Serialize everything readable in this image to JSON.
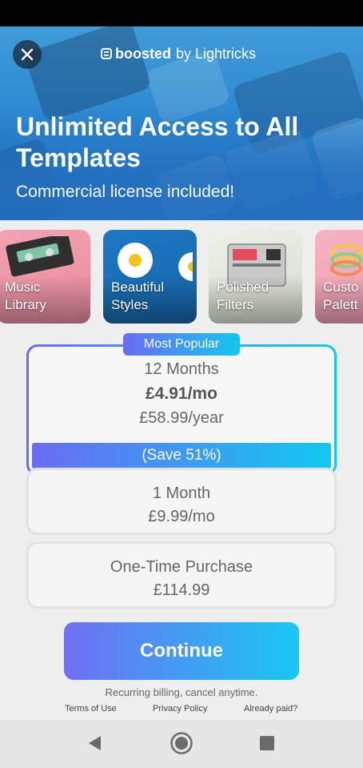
{
  "brand": {
    "name": "boosted",
    "by": "by Lightricks"
  },
  "hero": {
    "title": "Unlimited Access to All Templates",
    "subtitle": "Commercial license included!"
  },
  "features": [
    {
      "line1": "Music",
      "line2": "Library"
    },
    {
      "line1": "Beautiful",
      "line2": "Styles"
    },
    {
      "line1": "Polished",
      "line2": "Filters"
    },
    {
      "line1": "Custo",
      "line2": "Palett"
    }
  ],
  "plans": {
    "featured": {
      "badge": "Most Popular",
      "term": "12 Months",
      "per_month": "£4.91/mo",
      "per_year": "£58.99/year",
      "save": "(Save 51%)"
    },
    "monthly": {
      "term": "1 Month",
      "price": "£9.99/mo"
    },
    "onetime": {
      "term": "One-Time Purchase",
      "price": "£114.99"
    }
  },
  "cta": {
    "label": "Continue"
  },
  "footer": {
    "recurring": "Recurring billing, cancel anytime.",
    "terms": "Terms of Use",
    "privacy": "Privacy Policy",
    "already_paid": "Already paid?"
  },
  "colors": {
    "accent_start": "#6a6cf2",
    "accent_end": "#12c8f0",
    "hero_blue": "#2a86cf"
  },
  "icons": {
    "close": "close-icon",
    "logo": "boosted-logo-icon",
    "nav_back": "back-triangle-icon",
    "nav_home": "home-circle-icon",
    "nav_recent": "recents-square-icon"
  }
}
